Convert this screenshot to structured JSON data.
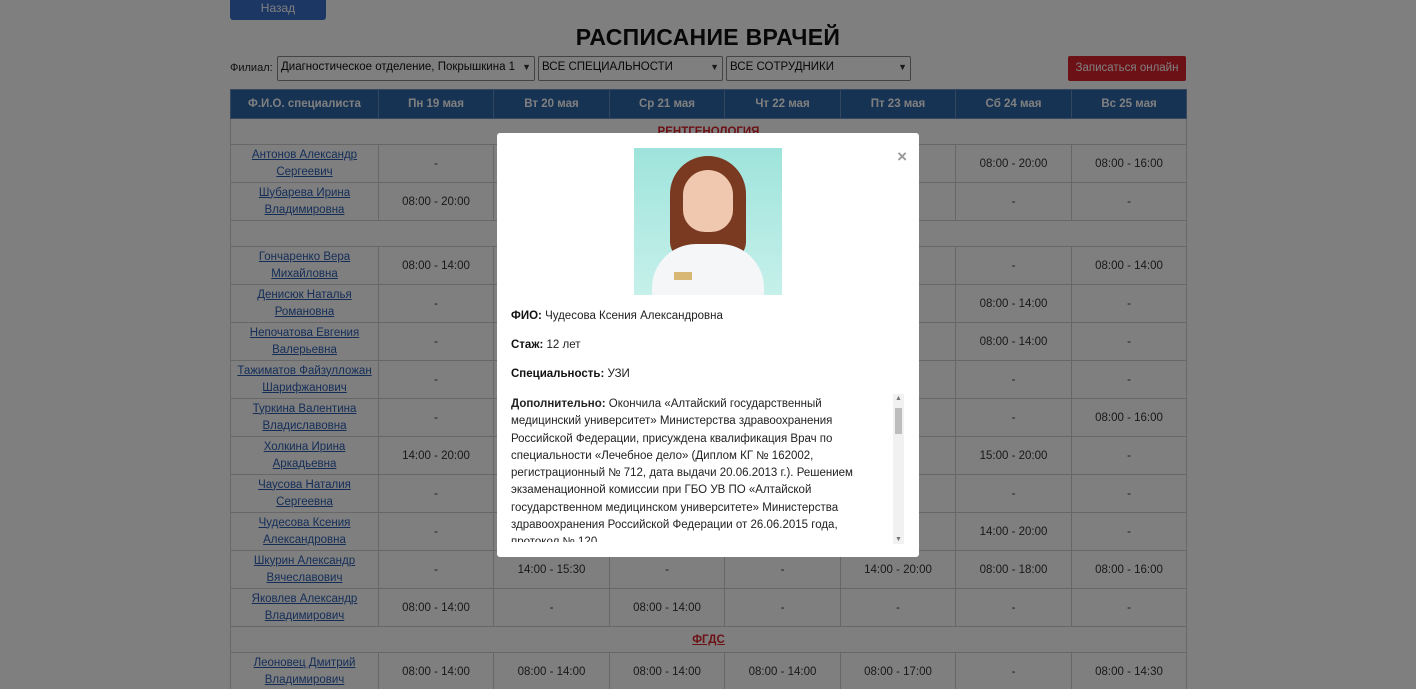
{
  "header": {
    "back_label": "Назад",
    "title": "РАСПИСАНИЕ ВРАЧЕЙ"
  },
  "filters": {
    "branch_label": "Филиал:",
    "branch_value": "Диагностическое отделение, Покрышкина 1",
    "specialty_value": "ВСЕ СПЕЦИАЛЬНОСТИ",
    "staff_value": "ВСЕ СОТРУДНИКИ",
    "online_button": "Записаться онлайн"
  },
  "table": {
    "columns": [
      "Ф.И.О. специалиста",
      "Пн 19 мая",
      "Вт 20 мая",
      "Ср 21 мая",
      "Чт 22 мая",
      "Пт 23 мая",
      "Сб 24 мая",
      "Вс 25 мая"
    ],
    "sections": [
      {
        "title": "РЕНТГЕНОЛОГИЯ",
        "rows": [
          {
            "name": "Антонов Александр Сергеевич",
            "cells": [
              "-",
              "",
              "",
              "",
              "",
              "08:00 - 20:00",
              "08:00 - 16:00"
            ]
          },
          {
            "name": "Шубарева Ирина Владимировна",
            "cells": [
              "08:00 - 20:00",
              "",
              "",
              "",
              "00",
              "-",
              "-"
            ]
          }
        ]
      },
      {
        "title": "",
        "rows": [
          {
            "name": "Гончаренко Вера Михайловна",
            "cells": [
              "08:00 - 14:00",
              "",
              "",
              "",
              "",
              "-",
              "08:00 - 14:00"
            ]
          },
          {
            "name": "Денисюк Наталья Романовна",
            "cells": [
              "-",
              "",
              "",
              "",
              "00",
              "08:00 - 14:00",
              "-"
            ]
          },
          {
            "name": "Непочатова Евгения Валерьевна",
            "cells": [
              "-",
              "",
              "",
              "",
              "",
              "08:00 - 14:00",
              "-"
            ]
          },
          {
            "name": "Тажиматов Файзулложан Шарифжанович",
            "cells": [
              "-",
              "",
              "",
              "",
              "30",
              "-",
              "-"
            ]
          },
          {
            "name": "Туркина Валентина Владиславовна",
            "cells": [
              "-",
              "",
              "",
              "",
              "00",
              "-",
              "08:00 - 16:00"
            ]
          },
          {
            "name": "Холкина Ирина Аркадьевна",
            "cells": [
              "14:00 - 20:00",
              "",
              "",
              "",
              "00",
              "15:00 - 20:00",
              "-"
            ]
          },
          {
            "name": "Чаусова Наталия Сергеевна",
            "cells": [
              "-",
              "",
              "",
              "",
              "",
              "-",
              "-"
            ]
          },
          {
            "name": "Чудесова Ксения Александровна",
            "cells": [
              "-",
              "",
              "",
              "",
              "00",
              "14:00 - 20:00",
              "-"
            ]
          },
          {
            "name": "Шкурин Александр Вячеславович",
            "cells": [
              "-",
              "14:00 - 15:30",
              "-",
              "-",
              "14:00 - 20:00",
              "08:00 - 18:00",
              "08:00 - 16:00"
            ]
          },
          {
            "name": "Яковлев Александр Владимирович",
            "cells": [
              "08:00 - 14:00",
              "-",
              "08:00 - 14:00",
              "-",
              "-",
              "-",
              "-"
            ]
          }
        ]
      },
      {
        "title": "ФГДС",
        "rows": [
          {
            "name": "Леоновец Дмитрий Владимирович",
            "cells": [
              "08:00 - 14:00",
              "08:00 - 14:00",
              "08:00 - 14:00",
              "08:00 - 14:00",
              "08:00 - 17:00",
              "-",
              "08:00 - 14:30"
            ]
          }
        ]
      }
    ]
  },
  "modal": {
    "close_symbol": "×",
    "fio_label": "ФИО:",
    "fio_value": "Чудесова Ксения Александровна",
    "experience_label": "Стаж:",
    "experience_value": "12 лет",
    "specialty_label": "Специальность:",
    "specialty_value": "УЗИ",
    "extra_label": "Дополнительно:",
    "extra_value": "Окончила «Алтайский государственный медицинский университет» Министерства здравоохранения Российской Федерации, присуждена квалификация Врач по специальности «Лечебное дело» (Диплом КГ № 162002, регистрационный № 712, дата выдачи 20.06.2013 г.). Решением экзаменационной комиссии при ГБО УВ ПО «Алтайской государственном медицинском университете» Министерства здравоохранения Российской Федерации от 26.06.2015 года, протокол № 120"
  }
}
